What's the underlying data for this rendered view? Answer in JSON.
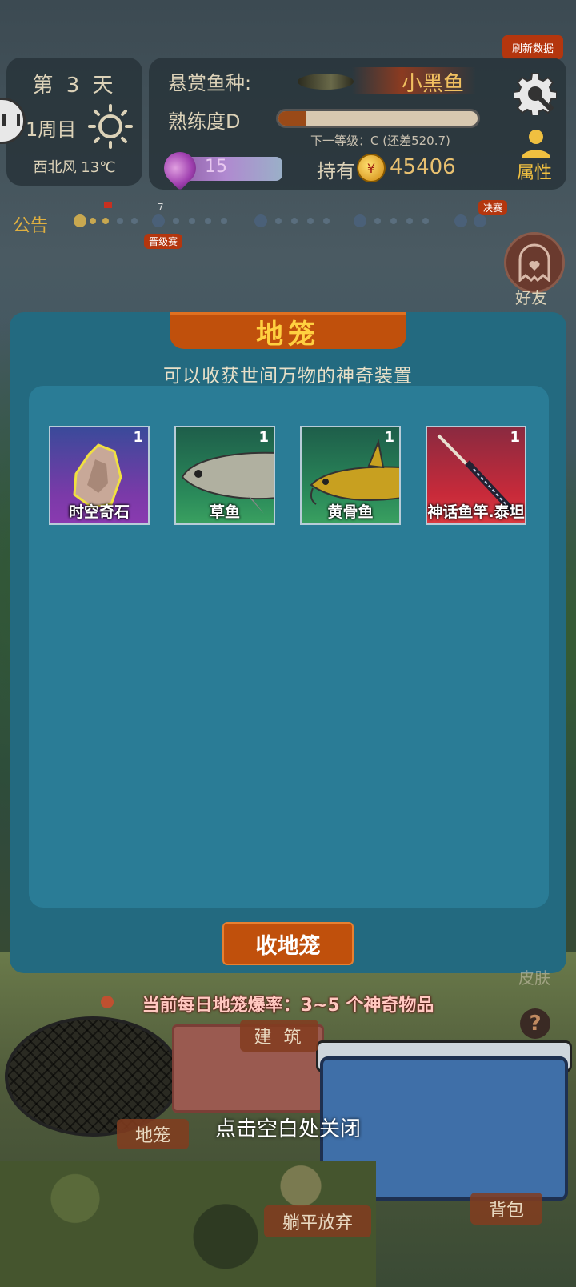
{
  "header": {
    "refresh_label": "刷新数据"
  },
  "day_panel": {
    "day": "第 3 天",
    "cycle": "1周目",
    "weather": "西北风 13℃"
  },
  "info_panel": {
    "bounty_label": "悬赏鱼种:",
    "bounty_fish": "小黑鱼",
    "proficiency_label": "熟练度D",
    "proficiency_progress": 0.14,
    "next_level": "下一等级：C (还差520.7)",
    "gem_count": "15",
    "hold_label": "持有",
    "coin_icon_text": "¥",
    "coins": "45406",
    "attr_label": "属性"
  },
  "announcement": {
    "label": "公告",
    "track_number": "7",
    "tag_promotion": "晋级赛",
    "tag_final": "决赛"
  },
  "friend": {
    "label": "好友"
  },
  "dialog": {
    "title": "地笼",
    "subtitle": "可以收获世间万物的神奇装置",
    "items": [
      {
        "name": "时空奇石",
        "count": "1",
        "rarity": "purple"
      },
      {
        "name": "草鱼",
        "count": "1",
        "rarity": "green"
      },
      {
        "name": "黄骨鱼",
        "count": "1",
        "rarity": "green"
      },
      {
        "name": "神话鱼竿.泰坦",
        "count": "1",
        "rarity": "red"
      }
    ],
    "collect_button": "收地笼"
  },
  "footer": {
    "rate_text": "当前每日地笼爆率：3~5 个神奇物品",
    "help_icon_text": "?",
    "build_button": "建 筑",
    "cage_button": "地笼",
    "close_hint": "点击空白处关闭",
    "give_up_button": "躺平放弃",
    "bag_button": "背包",
    "faded_label": "皮肤"
  }
}
